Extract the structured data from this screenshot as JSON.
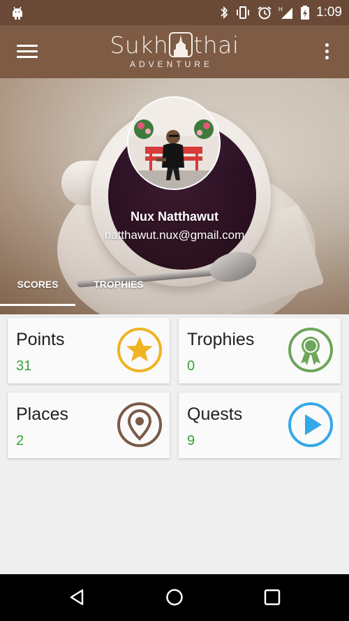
{
  "status_bar": {
    "time": "1:09",
    "icons": [
      "android-icon",
      "bluetooth-icon",
      "vibrate-icon",
      "alarm-icon",
      "signal-icon",
      "battery-icon"
    ]
  },
  "app_bar": {
    "logo_text_left": "Sukh",
    "logo_text_right": "thai",
    "logo_subtitle": "ADVENTURE",
    "menu_icon": "hamburger-menu-icon",
    "overflow_icon": "more-vert-icon"
  },
  "profile": {
    "name": "Nux Natthawut",
    "email": "natthawut.nux@gmail.com"
  },
  "tabs": [
    {
      "label": "SCORES",
      "active": true
    },
    {
      "label": "TROPHIES",
      "active": false
    }
  ],
  "cards": [
    {
      "title": "Points",
      "value": "31",
      "icon": "star-icon",
      "icon_color": "#f0b323"
    },
    {
      "title": "Trophies",
      "value": "0",
      "icon": "award-ribbon-icon",
      "icon_color": "#6fa55a"
    },
    {
      "title": "Places",
      "value": "2",
      "icon": "location-pin-icon",
      "icon_color": "#7b5a48"
    },
    {
      "title": "Quests",
      "value": "9",
      "icon": "play-icon",
      "icon_color": "#34a8e8"
    }
  ],
  "colors": {
    "status_bar": "#6a4a37",
    "app_bar": "#7e5b45",
    "value_green": "#3aa13a"
  },
  "nav_bar": {
    "icons": [
      "back-icon",
      "home-icon",
      "recents-icon"
    ]
  }
}
